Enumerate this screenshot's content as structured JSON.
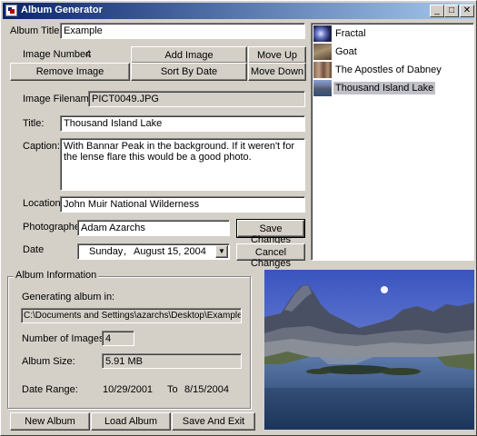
{
  "window": {
    "title": "Album Generator",
    "controls": {
      "minimize": "_",
      "maximize": "□",
      "close": "✕"
    }
  },
  "album": {
    "title_label": "Album Title",
    "title_value": "Example"
  },
  "image_number": {
    "label": "Image Number:",
    "value": "4"
  },
  "toolbar": {
    "add_image": "Add Image",
    "move_up": "Move Up",
    "remove_image": "Remove Image",
    "sort_by_date": "Sort By Date",
    "move_down": "Move Down"
  },
  "fields": {
    "filename_label": "Image Filename:",
    "filename_value": "PICT0049.JPG",
    "title_label": "Title:",
    "title_value": "Thousand Island Lake",
    "caption_label": "Caption:",
    "caption_value": "With Bannar Peak in the background.  If it weren't for the lense flare this would be a good photo.",
    "location_label": "Location",
    "location_value": "John Muir National Wilderness",
    "photographer_label": "Photographer",
    "photographer_value": "Adam Azarchs",
    "date_label": "Date",
    "date_weekday": "Sunday",
    "date_sep": ",",
    "date_month": "August",
    "date_day_year": "15, 2004"
  },
  "actions": {
    "save_changes": "Save Changes",
    "cancel_changes": "Cancel Changes"
  },
  "image_list": {
    "items": [
      {
        "label": "Fractal",
        "icon": "fractal-thumbnail"
      },
      {
        "label": "Goat",
        "icon": "goat-thumbnail"
      },
      {
        "label": "The Apostles of Dabney",
        "icon": "apostles-thumbnail"
      },
      {
        "label": "Thousand Island Lake",
        "icon": "lake-thumbnail",
        "selected": true
      }
    ]
  },
  "info": {
    "group_title": "Album Information",
    "generating_label": "Generating album in:",
    "generating_path": "C:\\Documents and Settings\\azarchs\\Desktop\\Example",
    "num_images_label": "Number of Images:",
    "num_images_value": "4",
    "size_label": "Album Size:",
    "size_value": "5.91 MB",
    "range_label": "Date Range:",
    "range_from": "10/29/2001",
    "range_to_label": "To",
    "range_to": "8/15/2004"
  },
  "bottom": {
    "new_album": "New Album",
    "load_album": "Load Album",
    "save_exit": "Save And Exit"
  },
  "colors": {
    "title_bar": "#0a246a",
    "face": "#d4d0c8",
    "selection": "#c0c0c8"
  }
}
